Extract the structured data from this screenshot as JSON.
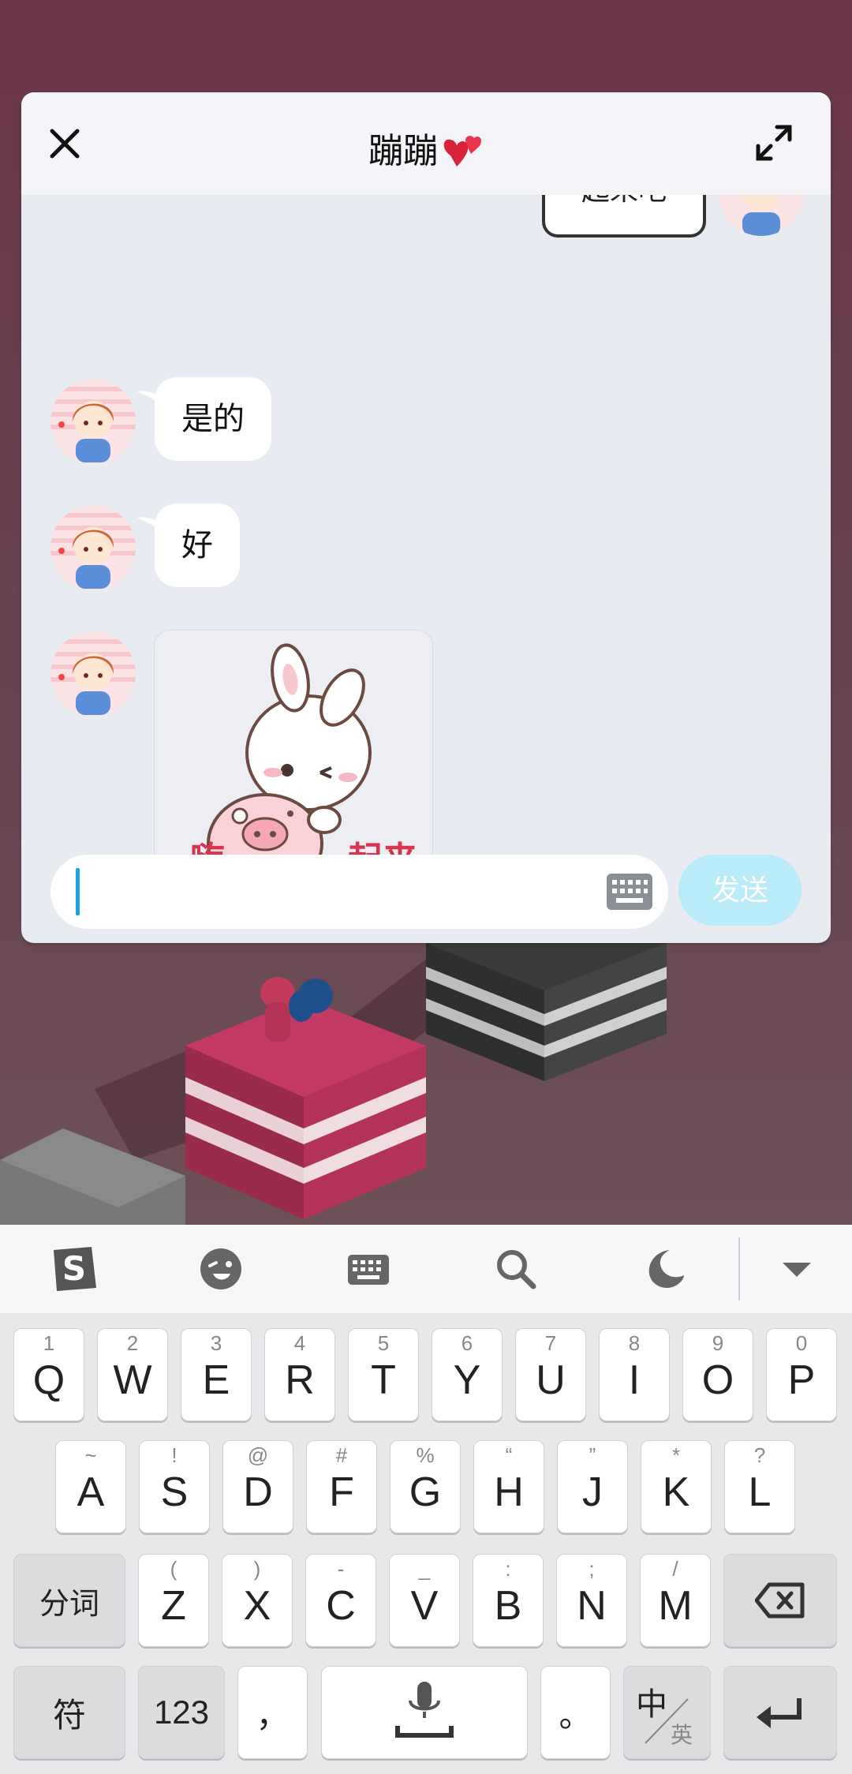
{
  "chat": {
    "title": "蹦蹦",
    "close_icon": "close-icon",
    "expand_icon": "expand-icon",
    "partial_message": "起来吧",
    "messages": [
      {
        "from": "other",
        "text": "是的"
      },
      {
        "from": "other",
        "text": "好"
      },
      {
        "from": "other",
        "type": "sticker",
        "sticker_texts": [
          "嗨",
          "起来"
        ]
      }
    ],
    "input": {
      "value": "",
      "placeholder": ""
    },
    "send_label": "发送"
  },
  "keyboard": {
    "toolbar": [
      "sogou-logo-icon",
      "emoji-icon",
      "keyboard-icon",
      "search-icon",
      "moon-icon",
      "collapse-icon"
    ],
    "row1": [
      {
        "main": "Q",
        "sub": "1"
      },
      {
        "main": "W",
        "sub": "2"
      },
      {
        "main": "E",
        "sub": "3"
      },
      {
        "main": "R",
        "sub": "4"
      },
      {
        "main": "T",
        "sub": "5"
      },
      {
        "main": "Y",
        "sub": "6"
      },
      {
        "main": "U",
        "sub": "7"
      },
      {
        "main": "I",
        "sub": "8"
      },
      {
        "main": "O",
        "sub": "9"
      },
      {
        "main": "P",
        "sub": "0"
      }
    ],
    "row2": [
      {
        "main": "A",
        "sub": "~"
      },
      {
        "main": "S",
        "sub": "!"
      },
      {
        "main": "D",
        "sub": "@"
      },
      {
        "main": "F",
        "sub": "#"
      },
      {
        "main": "G",
        "sub": "%"
      },
      {
        "main": "H",
        "sub": "“"
      },
      {
        "main": "J",
        "sub": "”"
      },
      {
        "main": "K",
        "sub": "*"
      },
      {
        "main": "L",
        "sub": "?"
      }
    ],
    "row3": [
      {
        "main": "Z",
        "sub": "("
      },
      {
        "main": "X",
        "sub": ")"
      },
      {
        "main": "C",
        "sub": "-"
      },
      {
        "main": "V",
        "sub": "_"
      },
      {
        "main": "B",
        "sub": ":"
      },
      {
        "main": "N",
        "sub": ";"
      },
      {
        "main": "M",
        "sub": "/"
      }
    ],
    "fenci": "分词",
    "fu": "符",
    "num": "123",
    "comma": "，",
    "period": "。",
    "zh": "中",
    "en": "英"
  }
}
